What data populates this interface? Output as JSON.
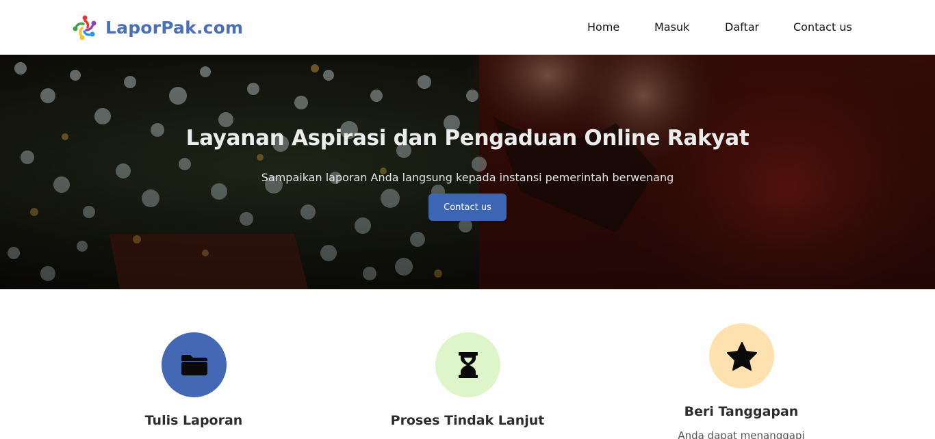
{
  "brand": {
    "name": "LaporPak.com",
    "logo_icon": "people-circle-logo-icon",
    "color": "#4a6fb5"
  },
  "nav": [
    {
      "label": "Home"
    },
    {
      "label": "Masuk"
    },
    {
      "label": "Daftar"
    },
    {
      "label": "Contact us"
    }
  ],
  "hero": {
    "title": "Layanan Aspirasi dan Pengaduan Online Rakyat",
    "subtitle": "Sampaikan laporan Anda langsung kepada instansi pemerintah berwenang",
    "button_label": "Contact us",
    "button_color": "#3c65b4"
  },
  "features": [
    {
      "title": "Tulis Laporan",
      "icon": "folder-icon",
      "circle_color": "#4468b3"
    },
    {
      "title": "Proses Tindak Lanjut",
      "icon": "hourglass-icon",
      "circle_color": "#ddf5c9"
    },
    {
      "title": "Beri Tanggapan",
      "icon": "star-icon",
      "circle_color": "#fde2b0",
      "description": "Anda dapat menanggapi"
    }
  ]
}
